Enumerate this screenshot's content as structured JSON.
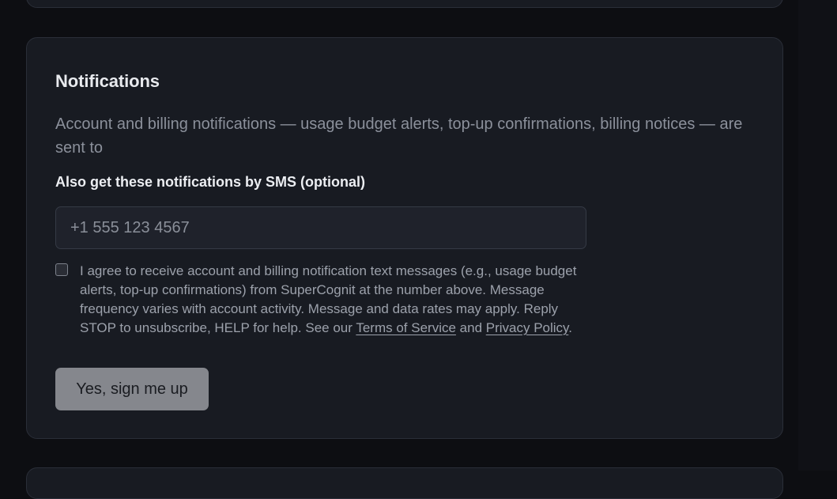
{
  "notifications": {
    "title": "Notifications",
    "description": "Account and billing notifications — usage budget alerts, top-up confirmations, billing notices — are sent to",
    "sms_label": "Also get these notifications by SMS (optional)",
    "phone_placeholder": "+1 555 123 4567",
    "phone_value": "",
    "consent_checked": false,
    "consent_text_before": "I agree to receive account and billing notification text messages (e.g., usage budget alerts, top-up confirmations) from SuperCognit at the number above. Message frequency varies with account activity. Message and data rates may apply. Reply STOP to unsubscribe, HELP for help. See our ",
    "terms_link": "Terms of Service",
    "consent_text_and": " and ",
    "privacy_link": "Privacy Policy",
    "consent_text_end": ".",
    "signup_button": "Yes, sign me up"
  },
  "colors": {
    "page_background": "#0d0e12",
    "card_background": "#181b22",
    "card_border": "#2a2e38",
    "input_background": "#1f222b",
    "button_background": "#85878d",
    "muted_text": "#8b909b"
  }
}
